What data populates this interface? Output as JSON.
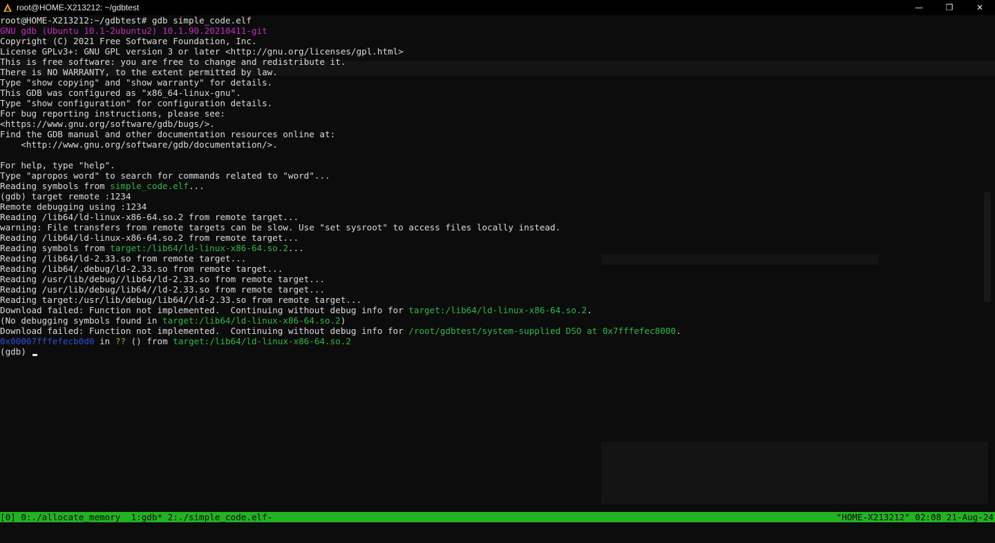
{
  "window": {
    "title": "root@HOME-X213212: ~/gdbtest",
    "minimize_glyph": "—",
    "maximize_glyph": "❐",
    "close_glyph": "✕"
  },
  "terminal": {
    "lines": [
      [
        {
          "t": "root@HOME-X213212:~/gdbtest# gdb simple_code.elf",
          "c": "white"
        }
      ],
      [
        {
          "t": "GNU gdb (Ubuntu 10.1-2ubuntu2) 10.1.90.20210411-git",
          "c": "mag"
        }
      ],
      [
        {
          "t": "Copyright (C) 2021 Free Software Foundation, Inc.",
          "c": "white"
        }
      ],
      [
        {
          "t": "License GPLv3+: GNU GPL version 3 or later <http://gnu.org/licenses/gpl.html>",
          "c": "white"
        }
      ],
      [
        {
          "t": "This is free software: you are free to change and redistribute it.",
          "c": "white"
        }
      ],
      [
        {
          "t": "There is NO WARRANTY, to the extent permitted by law.",
          "c": "white"
        }
      ],
      [
        {
          "t": "Type \"show copying\" and \"show warranty\" for details.",
          "c": "white"
        }
      ],
      [
        {
          "t": "This GDB was configured as \"x86_64-linux-gnu\".",
          "c": "white"
        }
      ],
      [
        {
          "t": "Type \"show configuration\" for configuration details.",
          "c": "white"
        }
      ],
      [
        {
          "t": "For bug reporting instructions, please see:",
          "c": "white"
        }
      ],
      [
        {
          "t": "<https://www.gnu.org/software/gdb/bugs/>.",
          "c": "white"
        }
      ],
      [
        {
          "t": "Find the GDB manual and other documentation resources online at:",
          "c": "white"
        }
      ],
      [
        {
          "t": "    <http://www.gnu.org/software/gdb/documentation/>.",
          "c": "white"
        }
      ],
      [
        {
          "t": "",
          "c": "white"
        }
      ],
      [
        {
          "t": "For help, type \"help\".",
          "c": "white"
        }
      ],
      [
        {
          "t": "Type \"apropos word\" to search for commands related to \"word\"...",
          "c": "white"
        }
      ],
      [
        {
          "t": "Reading symbols from ",
          "c": "white"
        },
        {
          "t": "simple_code.elf",
          "c": "green"
        },
        {
          "t": "...",
          "c": "white"
        }
      ],
      [
        {
          "t": "(gdb) target remote :1234",
          "c": "white"
        }
      ],
      [
        {
          "t": "Remote debugging using :1234",
          "c": "white"
        }
      ],
      [
        {
          "t": "Reading /lib64/ld-linux-x86-64.so.2 from remote target...",
          "c": "white"
        }
      ],
      [
        {
          "t": "warning: File transfers from remote targets can be slow. Use \"set sysroot\" to access files locally instead.",
          "c": "white"
        }
      ],
      [
        {
          "t": "Reading /lib64/ld-linux-x86-64.so.2 from remote target...",
          "c": "white"
        }
      ],
      [
        {
          "t": "Reading symbols from ",
          "c": "white"
        },
        {
          "t": "target:/lib64/ld-linux-x86-64.so.2",
          "c": "green"
        },
        {
          "t": "...",
          "c": "white"
        }
      ],
      [
        {
          "t": "Reading /lib64/ld-2.33.so from remote target...",
          "c": "white"
        }
      ],
      [
        {
          "t": "Reading /lib64/.debug/ld-2.33.so from remote target...",
          "c": "white"
        }
      ],
      [
        {
          "t": "Reading /usr/lib/debug//lib64/ld-2.33.so from remote target...",
          "c": "white"
        }
      ],
      [
        {
          "t": "Reading /usr/lib/debug/lib64//ld-2.33.so from remote target...",
          "c": "white"
        }
      ],
      [
        {
          "t": "Reading target:/usr/lib/debug/lib64//ld-2.33.so from remote target...",
          "c": "white"
        }
      ],
      [
        {
          "t": "Download failed: Function not implemented.  Continuing without debug info for ",
          "c": "white"
        },
        {
          "t": "target:/lib64/ld-linux-x86-64.so.2",
          "c": "green"
        },
        {
          "t": ".",
          "c": "white"
        }
      ],
      [
        {
          "t": "(No debugging symbols found in ",
          "c": "white"
        },
        {
          "t": "target:/lib64/ld-linux-x86-64.so.2",
          "c": "green"
        },
        {
          "t": ")",
          "c": "white"
        }
      ],
      [
        {
          "t": "Download failed: Function not implemented.  Continuing without debug info for ",
          "c": "white"
        },
        {
          "t": "/root/gdbtest/system-supplied DSO at 0x7fffefec8000",
          "c": "green"
        },
        {
          "t": ".",
          "c": "white"
        }
      ],
      [
        {
          "t": "0x00007fffefecb0d0",
          "c": "blue"
        },
        {
          "t": " in ",
          "c": "white"
        },
        {
          "t": "??",
          "c": "yellow"
        },
        {
          "t": " () from ",
          "c": "white"
        },
        {
          "t": "target:/lib64/ld-linux-x86-64.so.2",
          "c": "green"
        }
      ],
      [
        {
          "t": "(gdb) ",
          "c": "white"
        }
      ]
    ]
  },
  "tmux": {
    "left": "[0] 0:./allocate_memory  1:gdb* 2:./simple_code.elf-",
    "right": "\"HOME-X213212\" 02:08 21-Aug-24"
  }
}
